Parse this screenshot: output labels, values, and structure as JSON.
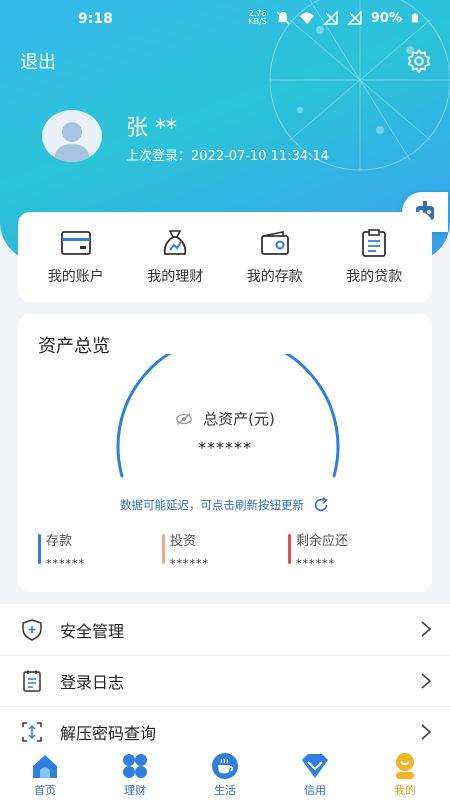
{
  "status": {
    "time": "9:18",
    "net_speed_value": "2.76",
    "net_speed_unit": "KB/S",
    "battery": "90%"
  },
  "header": {
    "logout_label": "退出"
  },
  "user": {
    "name": "张 **",
    "last_login": "上次登录：2022-07-10 11:34:14"
  },
  "quick": [
    {
      "label": "我的账户",
      "icon": "card-icon"
    },
    {
      "label": "我的理财",
      "icon": "money-bag-icon"
    },
    {
      "label": "我的存款",
      "icon": "wallet-icon"
    },
    {
      "label": "我的贷款",
      "icon": "clipboard-icon"
    }
  ],
  "assets": {
    "title": "资产总览",
    "total_label": "总资产(元)",
    "total_value": "******",
    "refresh_note": "数据可能延迟，可点击刷新按钮更新",
    "stats": [
      {
        "label": "存款",
        "value": "******",
        "color": "#2f7fe0"
      },
      {
        "label": "投资",
        "value": "******",
        "color": "#f2a883"
      },
      {
        "label": "剩余应还",
        "value": "******",
        "color": "#e84d4d"
      }
    ]
  },
  "menu": [
    {
      "label": "安全管理",
      "icon": "shield-icon"
    },
    {
      "label": "登录日志",
      "icon": "log-icon"
    },
    {
      "label": "解压密码查询",
      "icon": "password-icon"
    }
  ],
  "tabs": [
    {
      "label": "首页",
      "icon": "home-icon"
    },
    {
      "label": "理财",
      "icon": "finance-icon"
    },
    {
      "label": "生活",
      "icon": "life-icon"
    },
    {
      "label": "信用",
      "icon": "credit-icon"
    },
    {
      "label": "我的",
      "icon": "profile-icon",
      "active": true
    }
  ],
  "colors": {
    "accent": "#2f7fe0",
    "hero_start": "#35b8ea",
    "hero_end": "#3aa0f0",
    "active_tab": "#e0a21c"
  }
}
